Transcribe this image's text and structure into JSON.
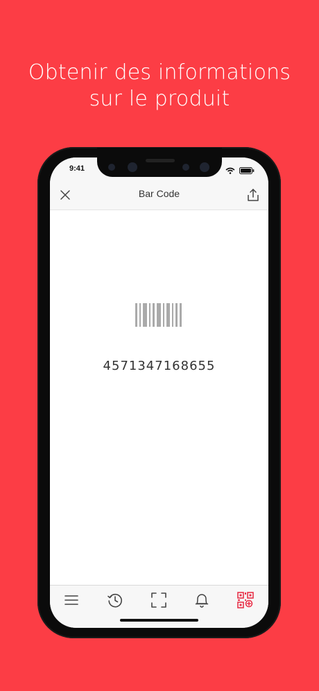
{
  "headline": {
    "line1": "Obtenir des informations",
    "line2": "sur le produit"
  },
  "status": {
    "time": "9:41",
    "icons": [
      "wifi-icon",
      "battery-icon"
    ]
  },
  "navbar": {
    "title": "Bar Code",
    "left_icon": "close-icon",
    "right_icon": "share-icon"
  },
  "scan_result": {
    "icon": "barcode-icon",
    "code": "4571347168655"
  },
  "tabbar": {
    "items": [
      {
        "icon": "menu-icon",
        "active": false
      },
      {
        "icon": "history-icon",
        "active": false
      },
      {
        "icon": "scan-icon",
        "active": false
      },
      {
        "icon": "bell-icon",
        "active": false
      },
      {
        "icon": "qr-code-icon",
        "active": true
      }
    ]
  },
  "colors": {
    "background": "#fc3d45",
    "accent": "#e8324a",
    "icon": "#444444"
  }
}
